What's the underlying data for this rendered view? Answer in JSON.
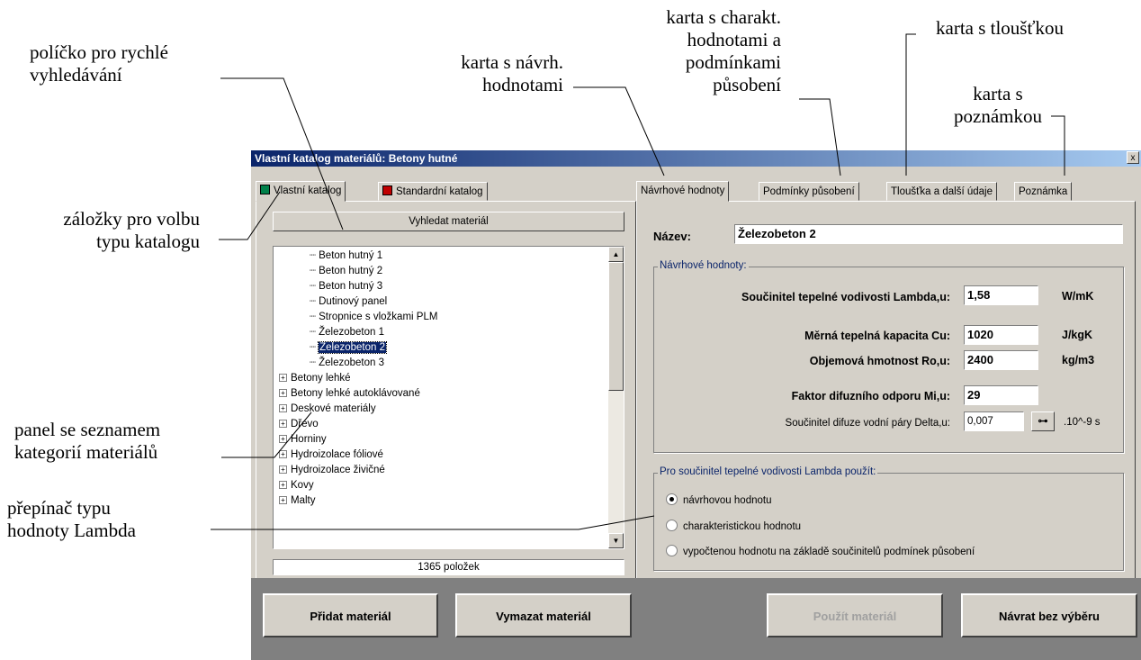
{
  "annotations": {
    "quick_search": [
      "políčko pro rychlé",
      "vyhledávání"
    ],
    "design_tab": [
      "karta s návrh.",
      "hodnotami"
    ],
    "char_tab": [
      "karta s charakt.",
      "hodnotami a",
      "podmínkami",
      "působení"
    ],
    "thickness_tab": "karta s tloušťkou",
    "note_tab": [
      "karta s",
      "poznámkou"
    ],
    "catalog_tabs": [
      "záložky pro volbu",
      "typu katalogu"
    ],
    "category_panel": [
      "panel se seznamem",
      "kategorií materiálů"
    ],
    "lambda_switch": [
      "přepínač typu",
      "hodnoty Lambda"
    ]
  },
  "window": {
    "title": "Vlastní katalog materiálů:  Betony hutné",
    "close": "x"
  },
  "catalog_tabs": [
    {
      "label": "Vlastní katalog",
      "color": "#00804a",
      "active": true
    },
    {
      "label": "Standardní katalog",
      "color": "#c00000",
      "active": false
    }
  ],
  "search_button": "Vyhledat materiál",
  "tree": {
    "children": [
      "Beton hutný 1",
      "Beton hutný 2",
      "Beton hutný 3",
      "Dutinový panel",
      "Stropnice s vložkami PLM",
      "Železobeton 1",
      "Železobeton 2",
      "Železobeton 3"
    ],
    "selected": "Železobeton 2",
    "categories": [
      "Betony lehké",
      "Betony lehké autoklávované",
      "Deskové materiály",
      "Dřevo",
      "Horniny",
      "Hydroizolace fóliové",
      "Hydroizolace živičné",
      "Kovy",
      "Malty"
    ]
  },
  "status": "1365 položek",
  "prop_tabs": [
    "Návrhové hodnoty",
    "Podmínky působení",
    "Tloušťka a další údaje",
    "Poznámka"
  ],
  "name": {
    "label": "Název:",
    "value": "Železobeton 2"
  },
  "design_group": {
    "title": "Návrhové hodnoty:",
    "lambda": {
      "label": "Součinitel tepelné vodivosti  Lambda,u:",
      "value": "1,58",
      "unit": "W/mK"
    },
    "cu": {
      "label": "Měrná tepelná kapacita  Cu:",
      "value": "1020",
      "unit": "J/kgK"
    },
    "ro": {
      "label": "Objemová hmotnost  Ro,u:",
      "value": "2400",
      "unit": "kg/m3"
    },
    "mi": {
      "label": "Faktor difuzního odporu  Mi,u:",
      "value": "29"
    },
    "delta": {
      "label": "Součinitel difuze vodní páry  Delta,u:",
      "value": "0,007",
      "unit": ".10^-9 s",
      "key_icon": "key-icon"
    }
  },
  "lambda_group": {
    "title": "Pro součinitel tepelné vodivosti Lambda použít:",
    "options": [
      "návrhovou hodnotu",
      "charakteristickou hodnotu",
      "vypočtenou hodnotu na základě součinitelů podmínek působení"
    ],
    "selected": 0
  },
  "buttons": {
    "add": "Přidat materiál",
    "delete": "Vymazat materiál",
    "use": "Použít materiál",
    "back": "Návrat bez výběru"
  }
}
